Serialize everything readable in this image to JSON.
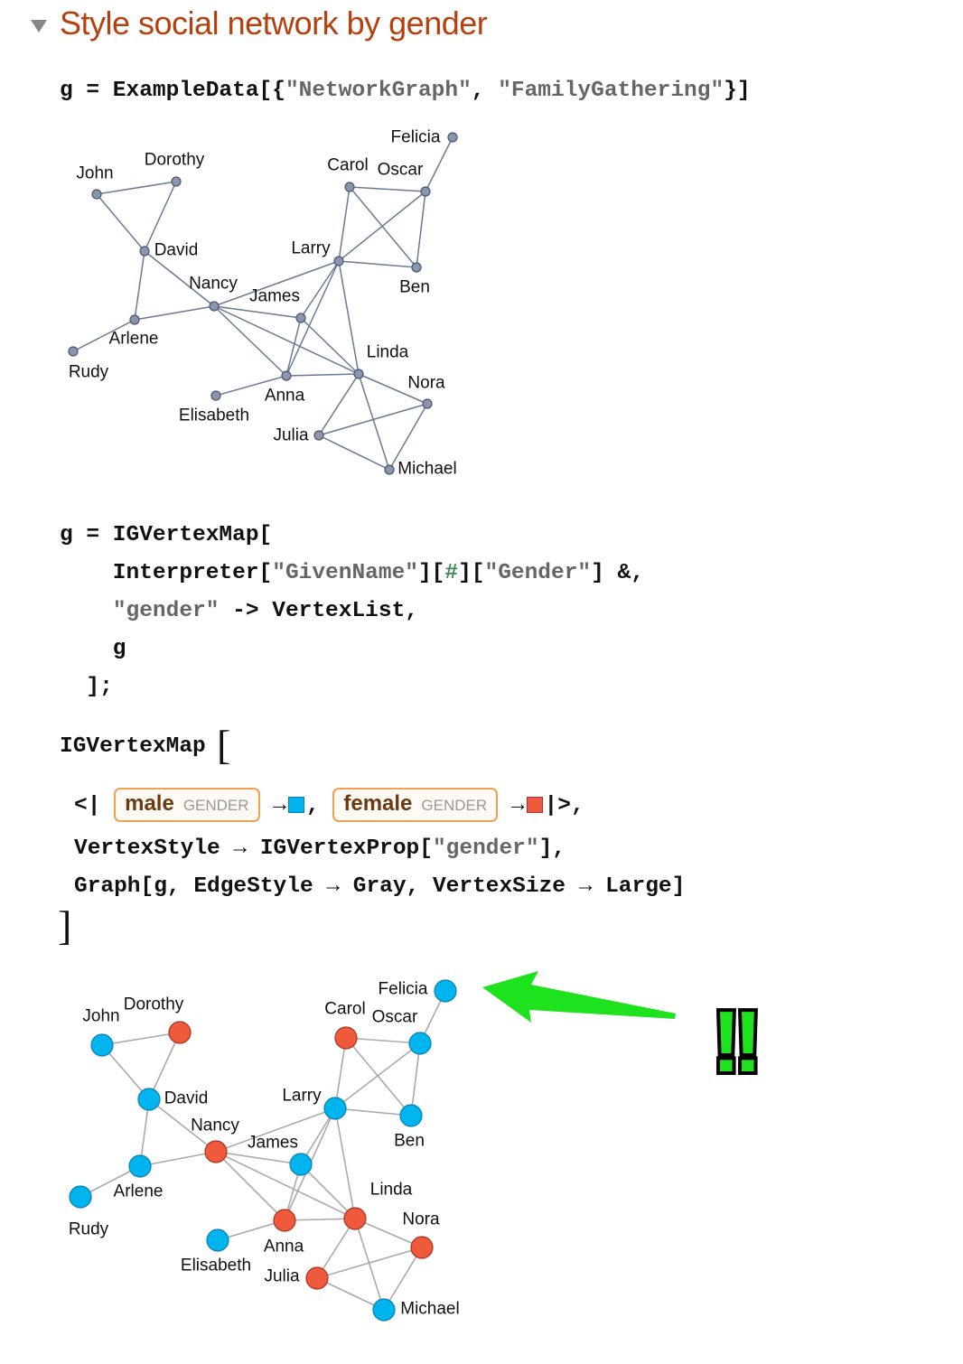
{
  "section": {
    "title": "Style social network by gender",
    "toggle_icon": "triangle-down-icon"
  },
  "cells": {
    "input1": [
      [
        [
          "g = ExampleData[{",
          ""
        ],
        [
          "\"NetworkGraph\"",
          "str"
        ],
        [
          ", ",
          ""
        ],
        [
          "\"FamilyGathering\"",
          "str"
        ],
        [
          "}]",
          ""
        ]
      ]
    ],
    "input2": [
      [
        [
          "g = IGVertexMap[",
          ""
        ]
      ],
      [
        [
          "    Interpreter[",
          ""
        ],
        [
          "\"GivenName\"",
          "str"
        ],
        [
          "][",
          ""
        ],
        [
          "#",
          "slot"
        ],
        [
          "][",
          ""
        ],
        [
          "\"Gender\"",
          "str"
        ],
        [
          "] &,",
          ""
        ]
      ],
      [
        [
          "    ",
          ""
        ],
        [
          "\"gender\"",
          "str"
        ],
        [
          " -> VertexList,",
          ""
        ]
      ],
      [
        [
          "    g",
          ""
        ]
      ],
      [
        [
          "  ];",
          ""
        ]
      ]
    ],
    "input3": {
      "head": "IGVertexMap",
      "assoc_open": "<|",
      "assoc_close": "|>,",
      "arrow": "→",
      "entities": [
        {
          "name": "male",
          "type": "GENDER",
          "color": "#00b4f0"
        },
        {
          "name": "female",
          "type": "GENDER",
          "color": "#f05a3c"
        }
      ],
      "line2": [
        [
          "VertexStyle → IGVertexProp[",
          ""
        ],
        [
          "\"gender\"",
          "str"
        ],
        [
          "],",
          ""
        ]
      ],
      "line3": [
        [
          "Graph[g, EdgeStyle → Gray, VertexSize → Large]",
          ""
        ]
      ]
    }
  },
  "graph": {
    "vertices": [
      {
        "name": "John",
        "gender": "male"
      },
      {
        "name": "Dorothy",
        "gender": "female"
      },
      {
        "name": "David",
        "gender": "male"
      },
      {
        "name": "Nancy",
        "gender": "female"
      },
      {
        "name": "Arlene",
        "gender": "male"
      },
      {
        "name": "Rudy",
        "gender": "male"
      },
      {
        "name": "James",
        "gender": "male"
      },
      {
        "name": "Anna",
        "gender": "female"
      },
      {
        "name": "Elisabeth",
        "gender": "male"
      },
      {
        "name": "Linda",
        "gender": "female"
      },
      {
        "name": "Larry",
        "gender": "male"
      },
      {
        "name": "Carol",
        "gender": "female"
      },
      {
        "name": "Oscar",
        "gender": "male"
      },
      {
        "name": "Felicia",
        "gender": "male"
      },
      {
        "name": "Ben",
        "gender": "male"
      },
      {
        "name": "Nora",
        "gender": "female"
      },
      {
        "name": "Julia",
        "gender": "female"
      },
      {
        "name": "Michael",
        "gender": "male"
      }
    ],
    "edges": [
      [
        "John",
        "Dorothy"
      ],
      [
        "John",
        "David"
      ],
      [
        "Dorothy",
        "David"
      ],
      [
        "David",
        "Arlene"
      ],
      [
        "David",
        "Nancy"
      ],
      [
        "Arlene",
        "Rudy"
      ],
      [
        "Arlene",
        "Nancy"
      ],
      [
        "Nancy",
        "Larry"
      ],
      [
        "Nancy",
        "James"
      ],
      [
        "Nancy",
        "Anna"
      ],
      [
        "Nancy",
        "Linda"
      ],
      [
        "James",
        "Anna"
      ],
      [
        "James",
        "Linda"
      ],
      [
        "James",
        "Larry"
      ],
      [
        "Anna",
        "Larry"
      ],
      [
        "Anna",
        "Elisabeth"
      ],
      [
        "Anna",
        "Linda"
      ],
      [
        "Larry",
        "Linda"
      ],
      [
        "Larry",
        "Carol"
      ],
      [
        "Larry",
        "Oscar"
      ],
      [
        "Larry",
        "Ben"
      ],
      [
        "Carol",
        "Oscar"
      ],
      [
        "Carol",
        "Ben"
      ],
      [
        "Oscar",
        "Ben"
      ],
      [
        "Oscar",
        "Felicia"
      ],
      [
        "Linda",
        "Nora"
      ],
      [
        "Linda",
        "Julia"
      ],
      [
        "Linda",
        "Michael"
      ],
      [
        "Julia",
        "Nora"
      ],
      [
        "Julia",
        "Michael"
      ],
      [
        "Nora",
        "Michael"
      ]
    ],
    "default_vertex_color": "#8a96ab",
    "default_edge_color": "#6a7a96",
    "styled_edge_color": "#aaaaaa",
    "gender_colors": {
      "male": "#00b4f0",
      "female": "#f05a3c"
    }
  },
  "annotation": {
    "arrow_color": "#1fe21f",
    "exclamation": "!!",
    "arrow_icon": "arrow-left-icon"
  }
}
